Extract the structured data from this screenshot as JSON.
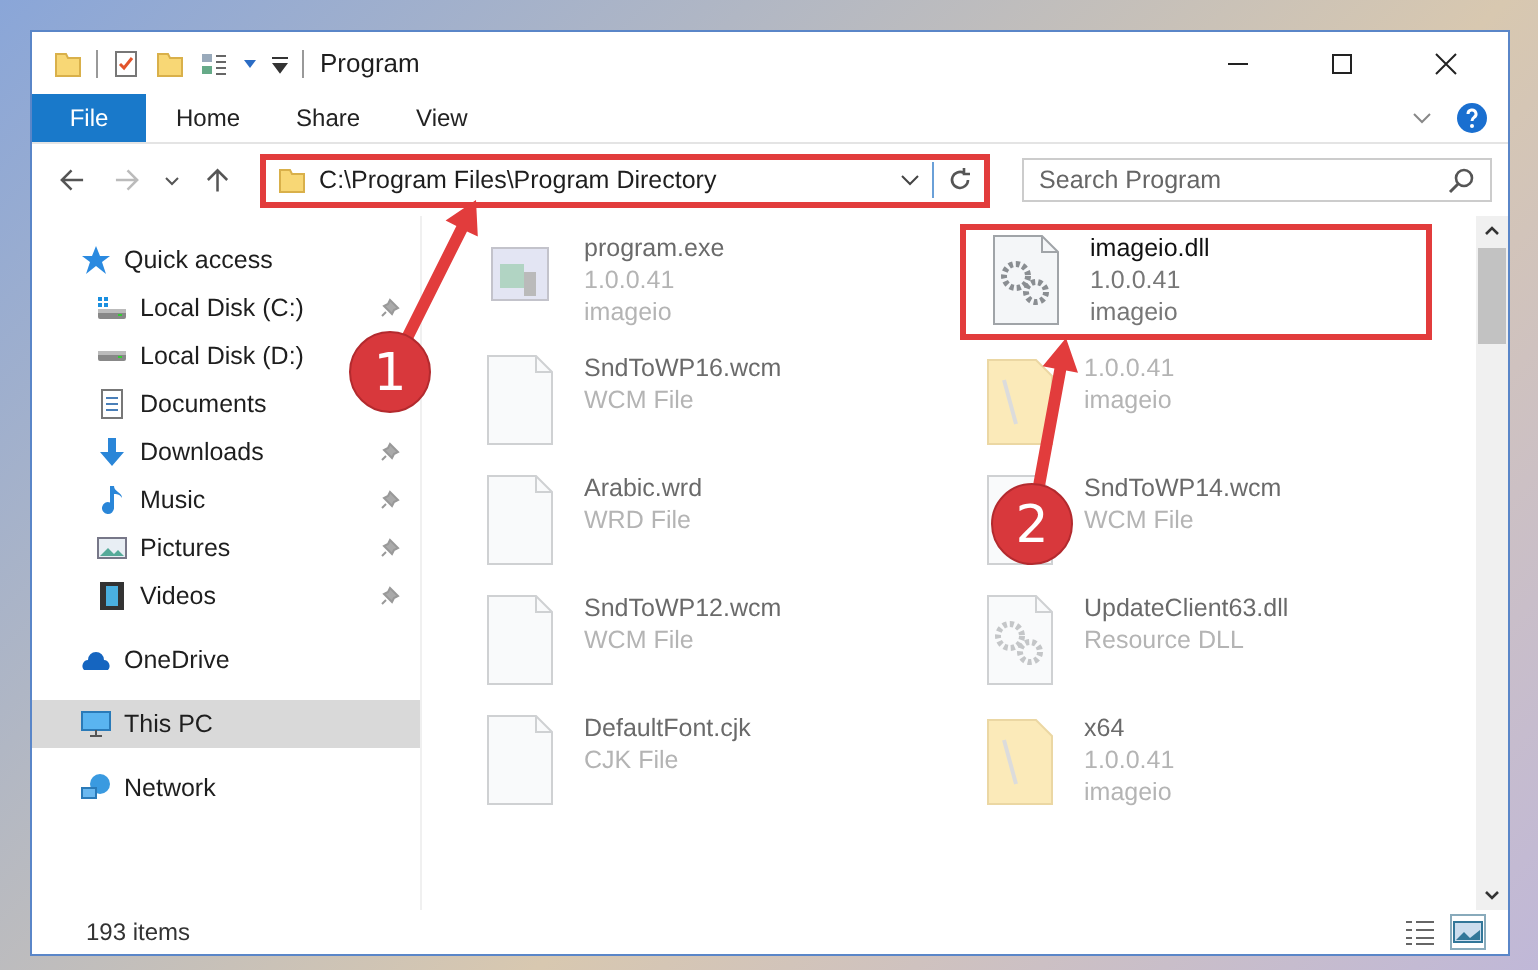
{
  "window": {
    "title": "Program"
  },
  "ribbon": {
    "tabs": [
      {
        "label": "File",
        "selected": true
      },
      {
        "label": "Home",
        "selected": false
      },
      {
        "label": "Share",
        "selected": false
      },
      {
        "label": "View",
        "selected": false
      }
    ]
  },
  "address_bar": {
    "path": "C:\\Program Files\\Program Directory",
    "highlighted": true
  },
  "search": {
    "placeholder": "Search Program"
  },
  "sidebar": {
    "items": [
      {
        "label": "Quick access",
        "kind": "star",
        "selected": false,
        "children": [
          {
            "label": "Local Disk (C:)",
            "kind": "system-drive",
            "pinned": true
          },
          {
            "label": "Local Disk (D:)",
            "kind": "drive",
            "pinned": false
          },
          {
            "label": "Documents",
            "kind": "documents",
            "pinned": false
          },
          {
            "label": "Downloads",
            "kind": "downloads",
            "pinned": true
          },
          {
            "label": "Music",
            "kind": "music",
            "pinned": true
          },
          {
            "label": "Pictures",
            "kind": "pictures",
            "pinned": true
          },
          {
            "label": "Videos",
            "kind": "videos",
            "pinned": true
          }
        ]
      },
      {
        "label": "OneDrive",
        "kind": "cloud",
        "selected": false
      },
      {
        "label": "This PC",
        "kind": "pc",
        "selected": true
      },
      {
        "label": "Network",
        "kind": "network",
        "selected": false
      }
    ]
  },
  "files": [
    {
      "name": "program.exe",
      "details": [
        "1.0.0.41",
        "imageio"
      ],
      "kind": "exe",
      "blurred": true,
      "highlighted": false
    },
    {
      "name": "imageio.dll",
      "details": [
        "1.0.0.41",
        "imageio"
      ],
      "kind": "dll",
      "blurred": false,
      "highlighted": true
    },
    {
      "name": "SndToWP16.wcm",
      "details": [
        "WCM File"
      ],
      "kind": "blank",
      "blurred": true,
      "highlighted": false
    },
    {
      "details": [
        "1.0.0.41",
        "imageio"
      ],
      "kind": "folder",
      "blurred": true,
      "highlighted": false
    },
    {
      "name": "Arabic.wrd",
      "details": [
        "WRD File"
      ],
      "kind": "blank",
      "blurred": true,
      "highlighted": false
    },
    {
      "name": "SndToWP14.wcm",
      "details": [
        "WCM File"
      ],
      "kind": "blank",
      "blurred": true,
      "highlighted": false
    },
    {
      "name": "SndToWP12.wcm",
      "details": [
        "WCM File"
      ],
      "kind": "blank",
      "blurred": true,
      "highlighted": false
    },
    {
      "name": "UpdateClient63.dll",
      "details": [
        "Resource DLL"
      ],
      "kind": "dll",
      "blurred": true,
      "highlighted": false
    },
    {
      "name": "DefaultFont.cjk",
      "details": [
        "CJK File"
      ],
      "kind": "blank",
      "blurred": true,
      "highlighted": false
    },
    {
      "name": "x64",
      "details": [
        "1.0.0.41",
        "imageio"
      ],
      "kind": "folder",
      "blurred": true,
      "highlighted": false
    }
  ],
  "annotations": [
    {
      "number": "1"
    },
    {
      "number": "2"
    }
  ],
  "status_bar": {
    "item_count": "193 items"
  }
}
